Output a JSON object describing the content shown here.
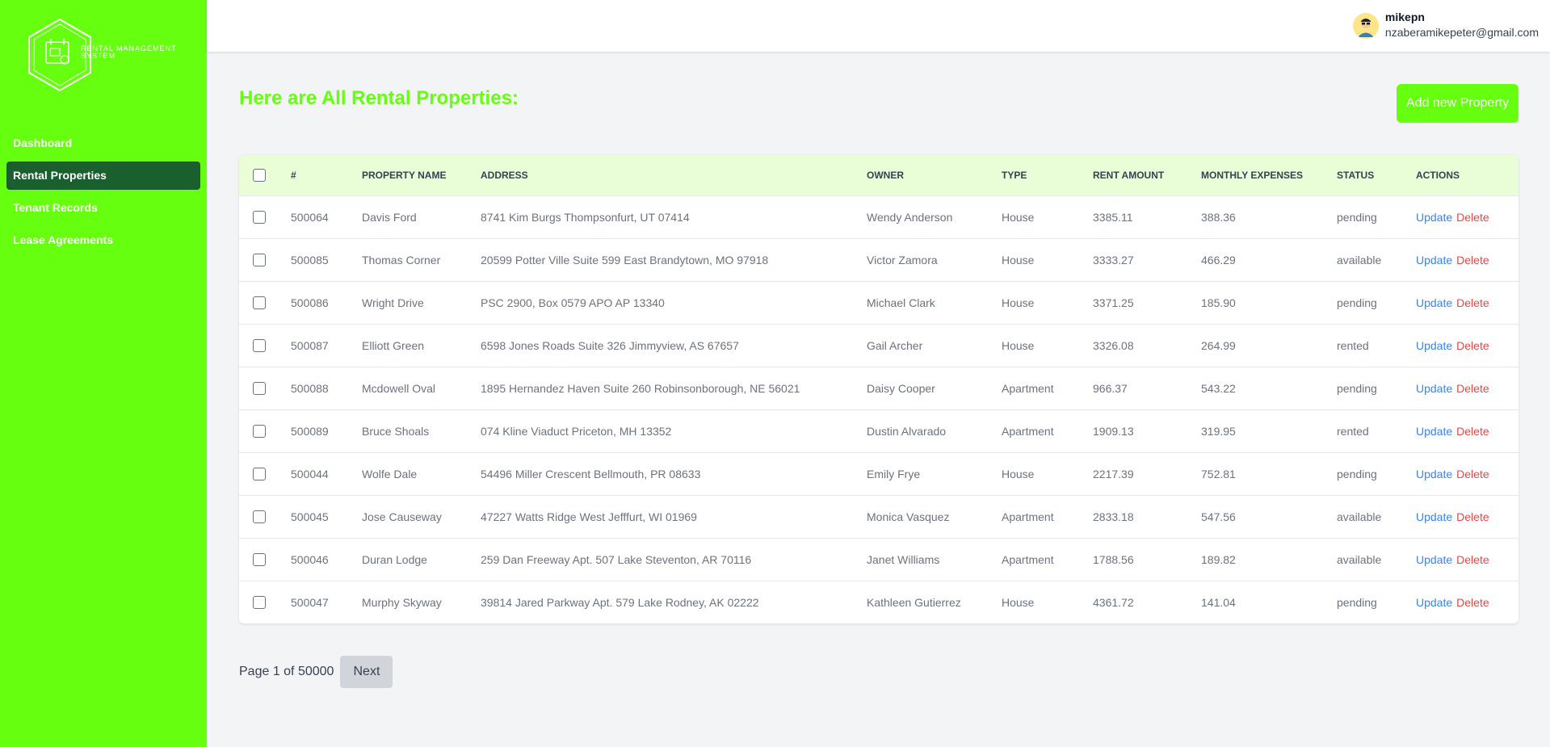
{
  "logo": {
    "line1": "RENTAL MANAGEMENT",
    "line2": "SYSTEM"
  },
  "sidebar": {
    "items": [
      {
        "label": "Dashboard",
        "active": false
      },
      {
        "label": "Rental Properties",
        "active": true
      },
      {
        "label": "Tenant Records",
        "active": false
      },
      {
        "label": "Lease Agreements",
        "active": false
      }
    ]
  },
  "user": {
    "name": "mikepn",
    "email": "nzaberamikepeter@gmail.com",
    "avatar_icon": "user-avatar-icon"
  },
  "page": {
    "title": "Here are All Rental Properties:",
    "add_button": "Add new Property"
  },
  "table": {
    "headers": [
      "#",
      "PROPERTY NAME",
      "ADDRESS",
      "OWNER",
      "TYPE",
      "RENT AMOUNT",
      "MONTHLY EXPENSES",
      "STATUS",
      "ACTIONS"
    ],
    "update_label": "Update",
    "delete_label": "Delete",
    "rows": [
      {
        "id": "500064",
        "name": "Davis Ford",
        "address": "8741 Kim Burgs Thompsonfurt, UT 07414",
        "owner": "Wendy Anderson",
        "type": "House",
        "rent": "3385.11",
        "expenses": "388.36",
        "status": "pending"
      },
      {
        "id": "500085",
        "name": "Thomas Corner",
        "address": "20599 Potter Ville Suite 599 East Brandytown, MO 97918",
        "owner": "Victor Zamora",
        "type": "House",
        "rent": "3333.27",
        "expenses": "466.29",
        "status": "available"
      },
      {
        "id": "500086",
        "name": "Wright Drive",
        "address": "PSC 2900, Box 0579 APO AP 13340",
        "owner": "Michael Clark",
        "type": "House",
        "rent": "3371.25",
        "expenses": "185.90",
        "status": "pending"
      },
      {
        "id": "500087",
        "name": "Elliott Green",
        "address": "6598 Jones Roads Suite 326 Jimmyview, AS 67657",
        "owner": "Gail Archer",
        "type": "House",
        "rent": "3326.08",
        "expenses": "264.99",
        "status": "rented"
      },
      {
        "id": "500088",
        "name": "Mcdowell Oval",
        "address": "1895 Hernandez Haven Suite 260 Robinsonborough, NE 56021",
        "owner": "Daisy Cooper",
        "type": "Apartment",
        "rent": "966.37",
        "expenses": "543.22",
        "status": "pending"
      },
      {
        "id": "500089",
        "name": "Bruce Shoals",
        "address": "074 Kline Viaduct Priceton, MH 13352",
        "owner": "Dustin Alvarado",
        "type": "Apartment",
        "rent": "1909.13",
        "expenses": "319.95",
        "status": "rented"
      },
      {
        "id": "500044",
        "name": "Wolfe Dale",
        "address": "54496 Miller Crescent Bellmouth, PR 08633",
        "owner": "Emily Frye",
        "type": "House",
        "rent": "2217.39",
        "expenses": "752.81",
        "status": "pending"
      },
      {
        "id": "500045",
        "name": "Jose Causeway",
        "address": "47227 Watts Ridge West Jefffurt, WI 01969",
        "owner": "Monica Vasquez",
        "type": "Apartment",
        "rent": "2833.18",
        "expenses": "547.56",
        "status": "available"
      },
      {
        "id": "500046",
        "name": "Duran Lodge",
        "address": "259 Dan Freeway Apt. 507 Lake Steventon, AR 70116",
        "owner": "Janet Williams",
        "type": "Apartment",
        "rent": "1788.56",
        "expenses": "189.82",
        "status": "available"
      },
      {
        "id": "500047",
        "name": "Murphy Skyway",
        "address": "39814 Jared Parkway Apt. 579 Lake Rodney, AK 02222",
        "owner": "Kathleen Gutierrez",
        "type": "House",
        "rent": "4361.72",
        "expenses": "141.04",
        "status": "pending"
      }
    ]
  },
  "pagination": {
    "text": "Page 1 of 50000",
    "next_label": "Next"
  },
  "colors": {
    "accent": "#66ff0f",
    "active_nav": "#1a5f2e",
    "header_row": "#e9fdd6",
    "update": "#3b82f6",
    "delete": "#ef4444"
  }
}
